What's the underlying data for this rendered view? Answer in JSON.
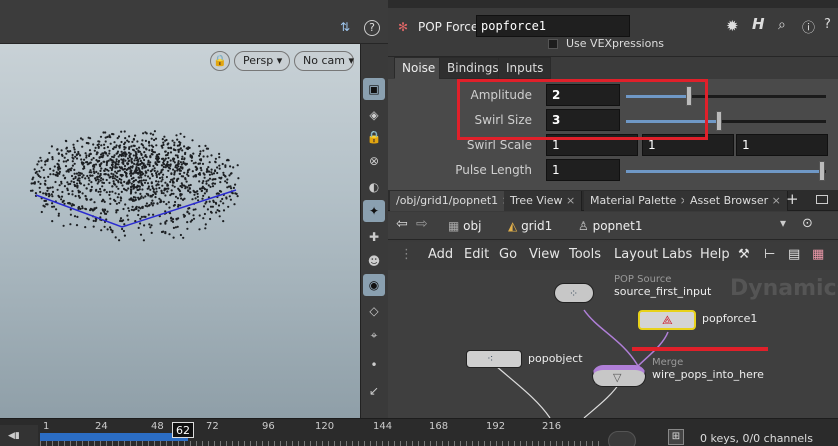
{
  "viewport": {
    "persp_label": "Persp",
    "cam_label": "No cam",
    "lock_glyph": "🔒",
    "side_icons": [
      "select-icon",
      "view-icon",
      "lock-icon",
      "ghost-icon",
      "display-icon",
      "light-icon",
      "gear-icon",
      "node-icon",
      "camera-icon",
      "vis-icon",
      "snap-icon",
      "dot-icon",
      "tool-icon"
    ]
  },
  "params": {
    "node_type": "POP Force",
    "node_name": "popforce1",
    "vex_label": "Use VEXpressions",
    "tabs": [
      "Noise",
      "Bindings",
      "Inputs"
    ],
    "active_tab": "Noise",
    "rows": [
      {
        "label": "Amplitude",
        "value": "2",
        "slider": 0.3
      },
      {
        "label": "Swirl Size",
        "value": "3",
        "slider": 0.45
      },
      {
        "label": "Swirl Scale",
        "values": [
          "1",
          "1",
          "1"
        ]
      },
      {
        "label": "Pulse Length",
        "value": "1",
        "slider": 1.0
      }
    ]
  },
  "network": {
    "tabs": [
      "/obj/grid1/popnet1",
      "Tree View",
      "Material Palette",
      "Asset Browser"
    ],
    "path": [
      "obj",
      "grid1",
      "popnet1"
    ],
    "menu": [
      "Add",
      "Edit",
      "Go",
      "View",
      "Tools",
      "Layout",
      "Labs",
      "Help"
    ],
    "context_label": "Dynamics",
    "nodes": [
      {
        "type": "POP Source",
        "name": "source_first_input"
      },
      {
        "type": "",
        "name": "popforce1"
      },
      {
        "type": "",
        "name": "popobject"
      },
      {
        "type": "Merge",
        "name": "wire_pops_into_here"
      }
    ]
  },
  "timeline": {
    "ticks": [
      "1",
      "24",
      "48",
      "72",
      "96",
      "120",
      "144",
      "168",
      "192",
      "216"
    ],
    "current_frame": "62",
    "status": "0 keys, 0/0 channels"
  }
}
